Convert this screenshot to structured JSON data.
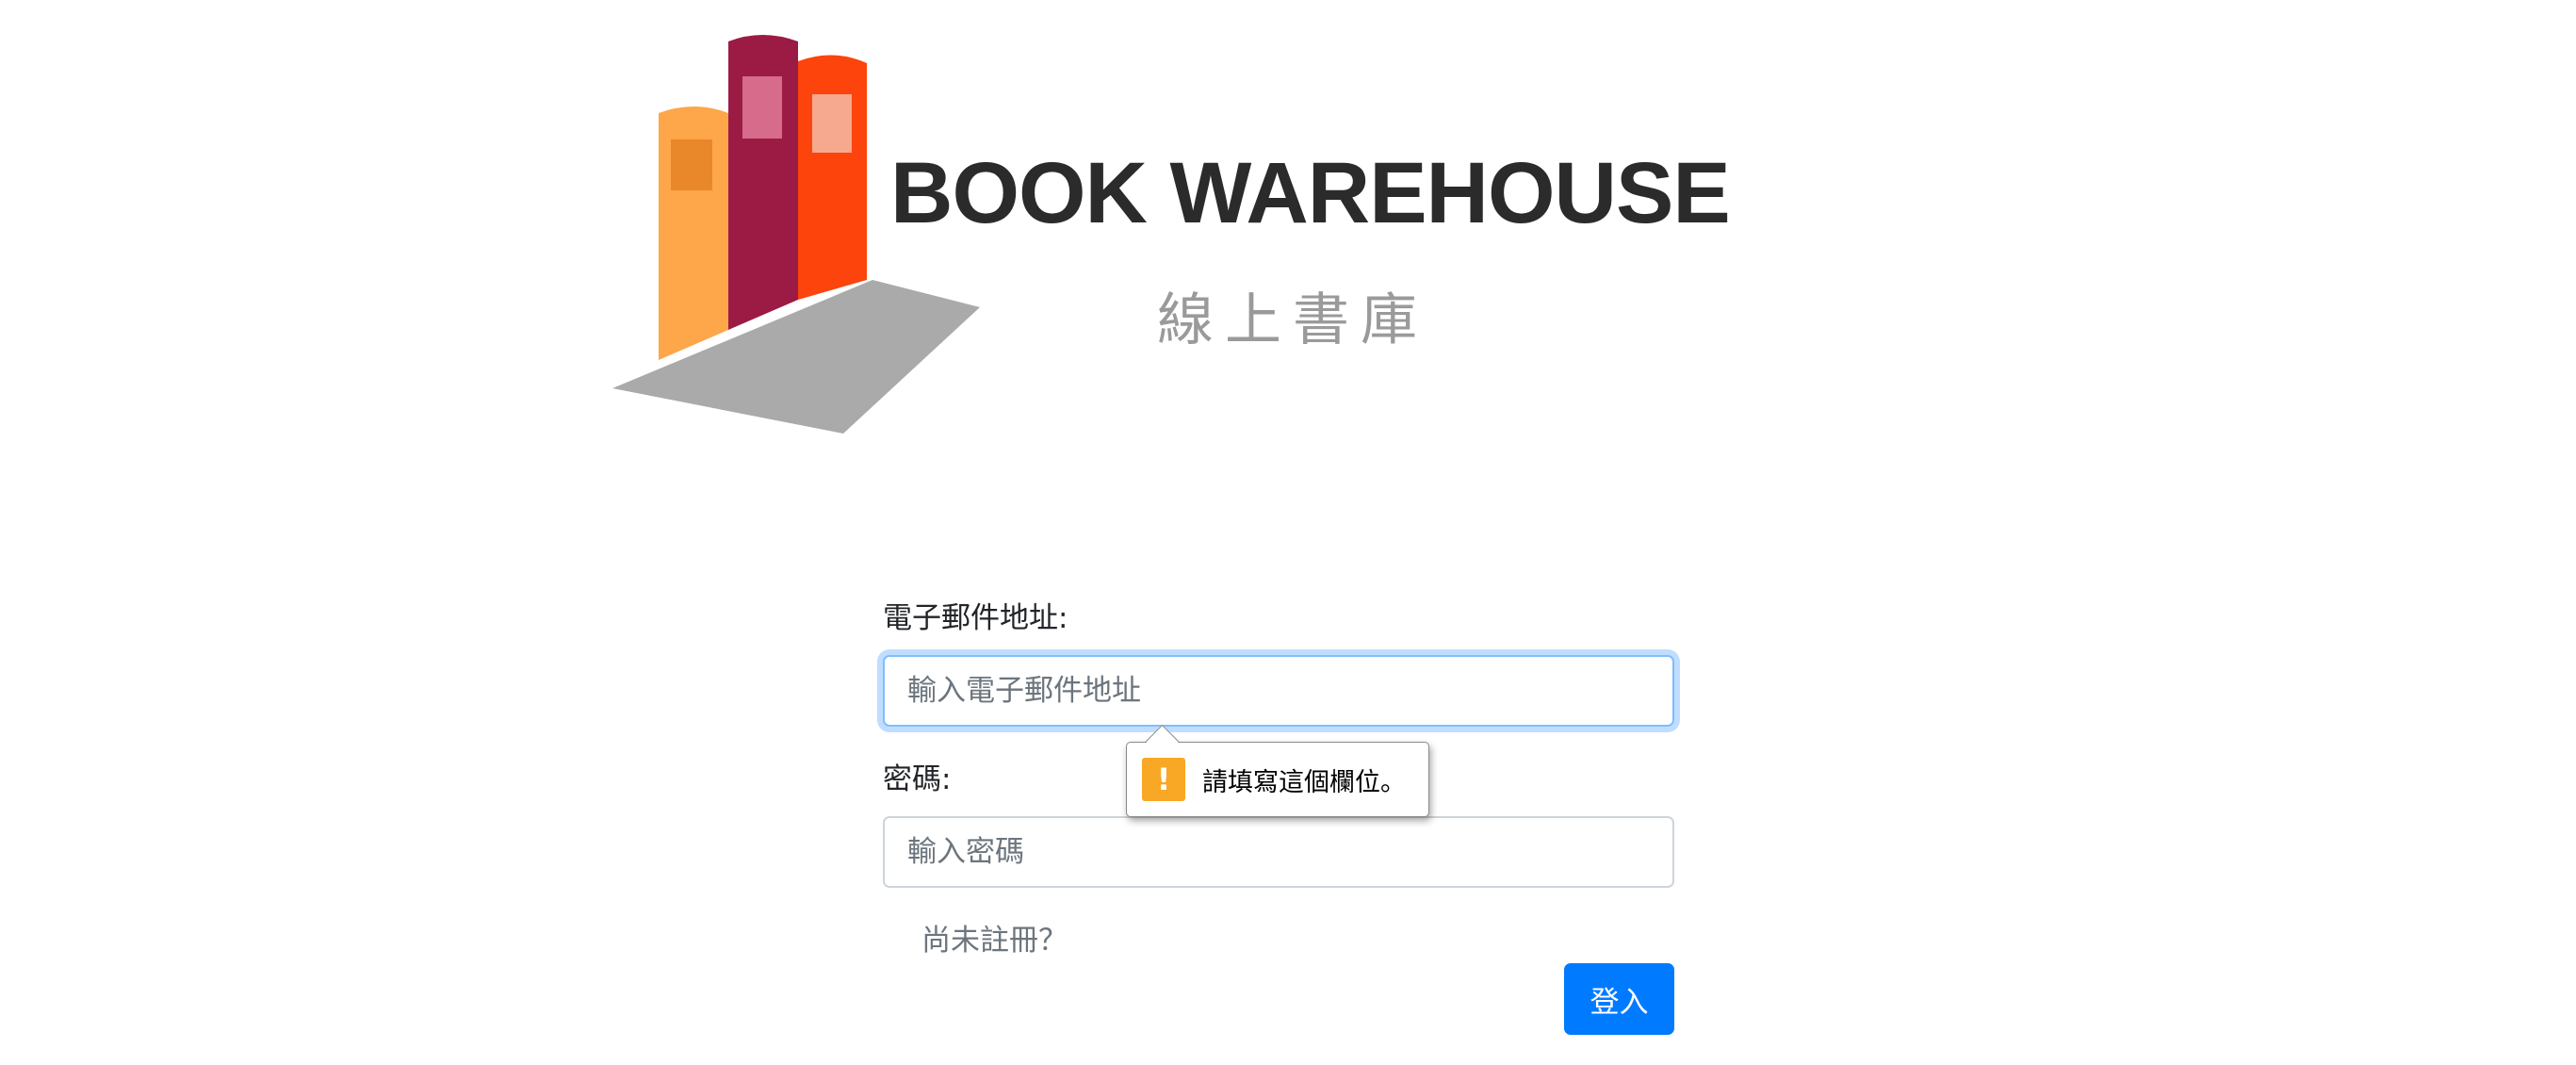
{
  "brand": {
    "title": "BOOK WAREHOUSE",
    "subtitle": "線上書庫",
    "colors": {
      "book_orange": "#fda64a",
      "book_maroon": "#9b1b44",
      "book_red": "#fc440c",
      "shadow": "#aaaaaa"
    }
  },
  "form": {
    "email": {
      "label": "電子郵件地址:",
      "placeholder": "輸入電子郵件地址",
      "value": ""
    },
    "password": {
      "label": "密碼:",
      "placeholder": "輸入密碼",
      "value": ""
    },
    "validation_tooltip": {
      "icon": "warning-icon",
      "icon_glyph": "!",
      "message": "請填寫這個欄位。"
    },
    "register_link": "尚未註冊？",
    "login_button": "登入"
  },
  "colors": {
    "primary": "#007bff",
    "warning": "#f9a825",
    "focus_ring": "#80bdff"
  }
}
